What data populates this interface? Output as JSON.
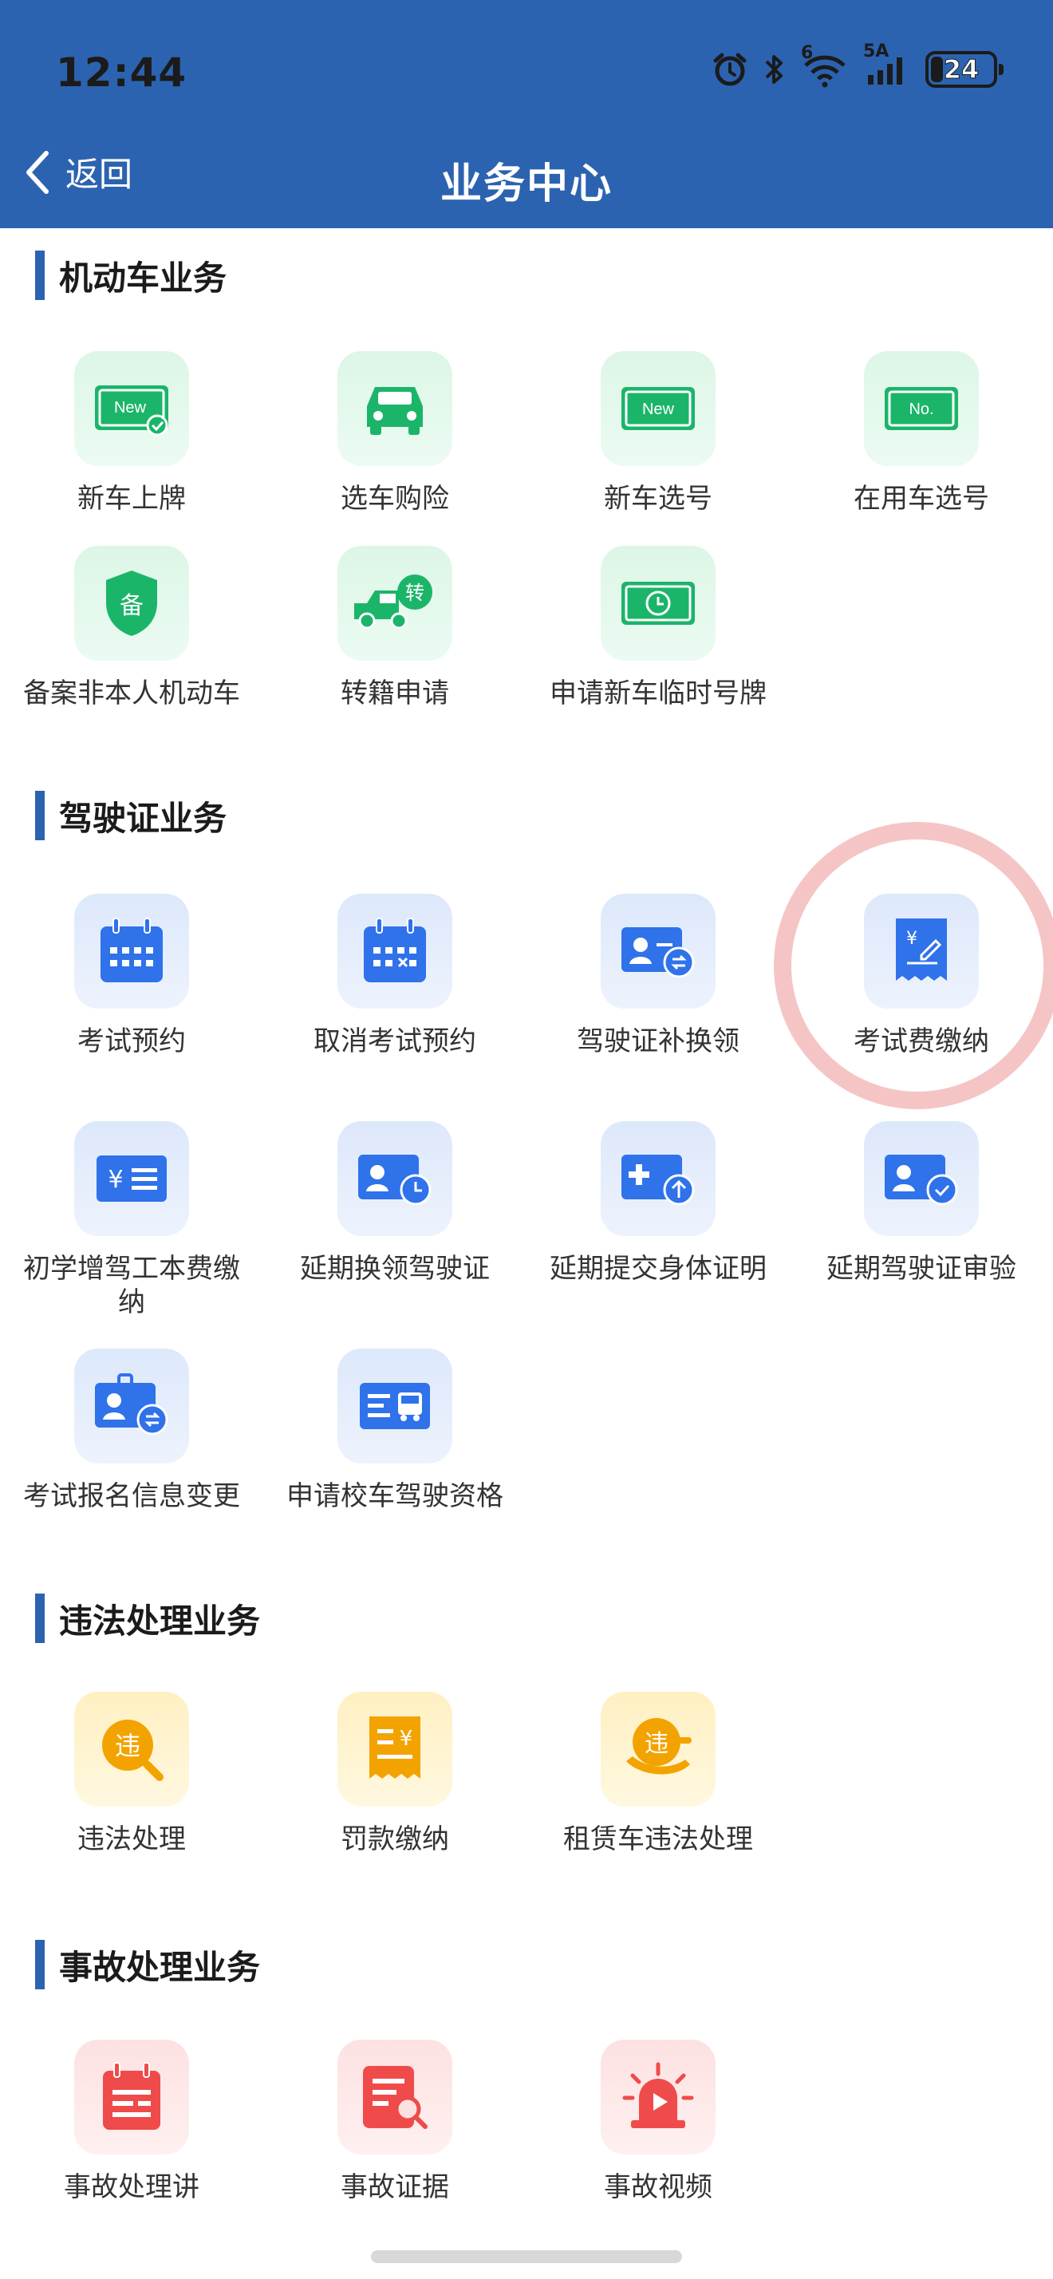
{
  "status_bar": {
    "time": "12:44",
    "network": "5A",
    "wifi_badge": "6",
    "battery": "24"
  },
  "nav": {
    "back_label": "返回",
    "title": "业务中心"
  },
  "colors": {
    "header": "#2c63b0",
    "green_icon": "#1bb56a",
    "blue_icon": "#2f72ea",
    "yellow_icon": "#f3a300",
    "red_icon": "#ef4b4b"
  },
  "sections": [
    {
      "title": "机动车业务",
      "items": [
        {
          "label": "新车上牌",
          "icon": "new-plate-icon"
        },
        {
          "label": "选车购险",
          "icon": "car-insurance-icon"
        },
        {
          "label": "新车选号",
          "icon": "new-number-icon"
        },
        {
          "label": "在用车选号",
          "icon": "number-select-icon"
        },
        {
          "label": "备案非本人机动车",
          "icon": "record-shield-icon"
        },
        {
          "label": "转籍申请",
          "icon": "transfer-truck-icon"
        },
        {
          "label": "申请新车临时号牌",
          "icon": "temporary-plate-icon"
        }
      ]
    },
    {
      "title": "驾驶证业务",
      "items": [
        {
          "label": "考试预约",
          "icon": "calendar-icon"
        },
        {
          "label": "取消考试预约",
          "icon": "calendar-cancel-icon"
        },
        {
          "label": "驾驶证补换领",
          "icon": "license-exchange-icon"
        },
        {
          "label": "考试费缴纳",
          "icon": "fee-receipt-icon"
        },
        {
          "label": "初学增驾工本费缴纳",
          "icon": "fee-card-icon"
        },
        {
          "label": "延期换领驾驶证",
          "icon": "license-clock-icon"
        },
        {
          "label": "延期提交身体证明",
          "icon": "medical-upload-icon"
        },
        {
          "label": "延期驾驶证审验",
          "icon": "license-check-icon"
        },
        {
          "label": "考试报名信息变更",
          "icon": "info-change-icon"
        },
        {
          "label": "申请校车驾驶资格",
          "icon": "school-bus-icon"
        }
      ]
    },
    {
      "title": "违法处理业务",
      "items": [
        {
          "label": "违法处理",
          "icon": "violation-search-icon"
        },
        {
          "label": "罚款缴纳",
          "icon": "fine-receipt-icon"
        },
        {
          "label": "租赁车违法处理",
          "icon": "rental-violation-icon"
        }
      ]
    },
    {
      "title": "事故处理业务",
      "items": [
        {
          "label": "事故处理讲",
          "icon": "accident-calendar-icon"
        },
        {
          "label": "事故证据",
          "icon": "evidence-search-icon"
        },
        {
          "label": "事故视频",
          "icon": "alarm-video-icon"
        }
      ]
    }
  ]
}
